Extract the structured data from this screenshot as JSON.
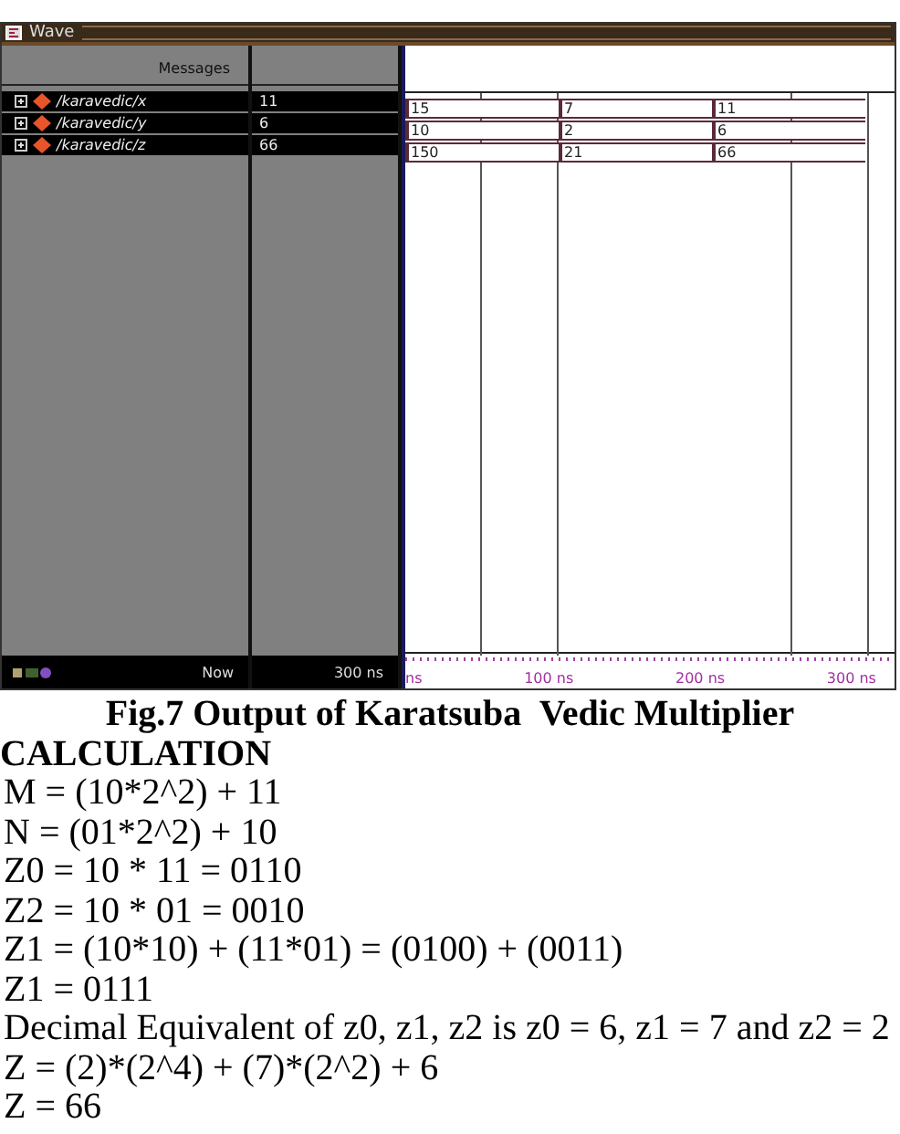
{
  "window": {
    "title": "Wave"
  },
  "header": {
    "messages": "Messages"
  },
  "signals": [
    {
      "name": "/karavedic/x",
      "value": "11",
      "segments": [
        "15",
        "7",
        "11"
      ]
    },
    {
      "name": "/karavedic/y",
      "value": "6",
      "segments": [
        "10",
        "2",
        "6"
      ]
    },
    {
      "name": "/karavedic/z",
      "value": "66",
      "segments": [
        "150",
        "21",
        "66"
      ]
    }
  ],
  "footer": {
    "now_label": "Now",
    "now_value": "300 ns",
    "time_ticks": [
      "ns",
      "100 ns",
      "200 ns",
      "300 ns"
    ]
  },
  "caption": "Fig.7 Output of Karatsuba  Vedic Multiplier",
  "heading": "CALCULATION",
  "lines": [
    "M = (10*2^2) + 11",
    "N = (01*2^2) + 10",
    "Z0 = 10 * 11 = 0110",
    "Z2 = 10 * 01 = 0010",
    "Z1 = (10*10) + (11*01) = (0100) + (0011)",
    "Z1 = 0111",
    "Decimal Equivalent of z0, z1, z2 is z0 = 6, z1 = 7 and z2 = 2",
    "Z = (2)*(2^4) + (7)*(2^2) + 6",
    "Z = 66"
  ]
}
